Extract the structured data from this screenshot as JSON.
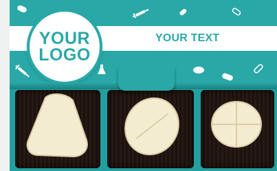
{
  "logo": {
    "line1": "YOUR",
    "line2": "LOGO"
  },
  "custom_text": "YOUR TEXT",
  "colors": {
    "brand": "#2aa8a8",
    "chocolate_tray": "#1f130e",
    "white_chocolate": "#f3ecd0"
  },
  "decor_icons": [
    "pill-icon",
    "syringe-icon",
    "capsule-icon",
    "flask-icon",
    "tablet-icon"
  ],
  "chocolates": [
    "triangle-white-chocolate",
    "oval-white-chocolate",
    "round-white-chocolate"
  ]
}
